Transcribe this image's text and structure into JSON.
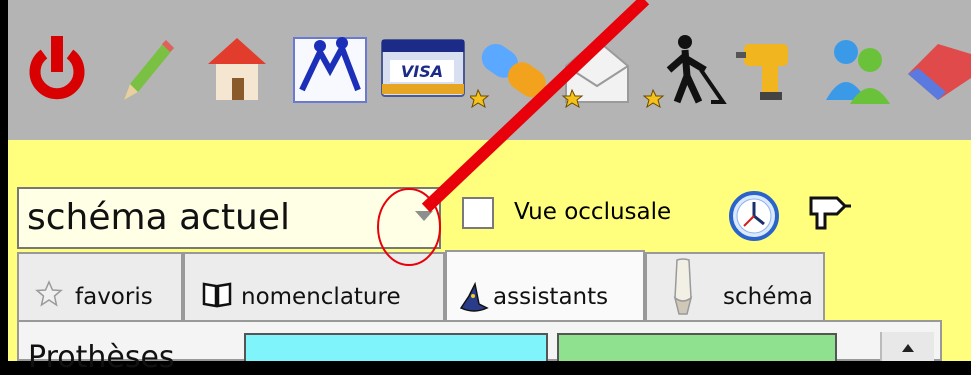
{
  "toolbar": {
    "icons": [
      "power-icon",
      "pencil-icon",
      "house-icon",
      "people-icon",
      "visa-card-icon",
      "pill-icon",
      "envelope-icon",
      "worker-icon",
      "drill-icon",
      "users-icon",
      "eraser-icon"
    ]
  },
  "selector": {
    "value": "schéma actuel"
  },
  "occlusal": {
    "label": "Vue occlusale",
    "checked": false
  },
  "tabs": [
    {
      "label": "favoris",
      "icon": "star-icon",
      "active": false
    },
    {
      "label": "nomenclature",
      "icon": "book-icon",
      "active": false
    },
    {
      "label": "assistants",
      "icon": "wizard-hat-icon",
      "active": true
    },
    {
      "label": "schéma",
      "icon": "tooth-icon",
      "active": false
    }
  ],
  "content": {
    "section_title": "Prothèses"
  },
  "colors": {
    "toolbar_bg": "#b4b4b4",
    "panel_bg": "#ffff7d",
    "annotation": "#e8000b"
  }
}
